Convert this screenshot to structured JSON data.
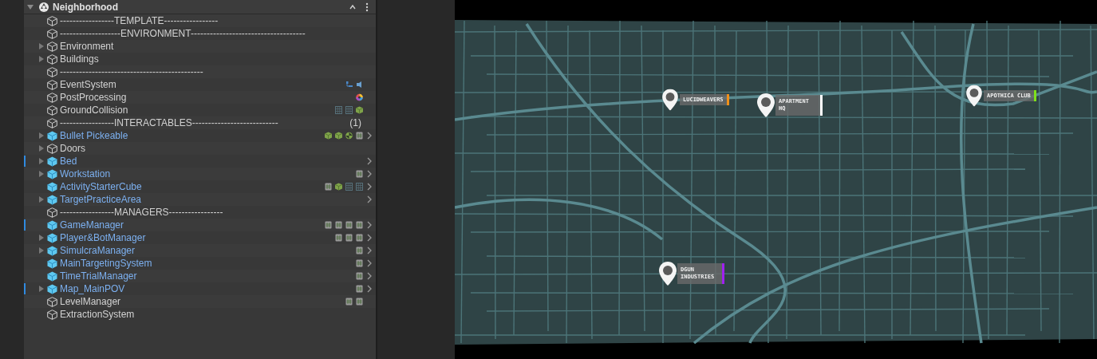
{
  "hierarchy": {
    "scene": {
      "label": "Neighborhood",
      "expanded": true
    },
    "rows": [
      {
        "label": "-----------------TEMPLATE-----------------",
        "prefab": false,
        "expandable": false,
        "marked": false,
        "chevron": false
      },
      {
        "label": "-------------------ENVIRONMENT------------------------------------",
        "prefab": false,
        "expandable": false,
        "marked": false,
        "chevron": false
      },
      {
        "label": "Environment",
        "prefab": false,
        "expandable": true,
        "marked": false,
        "chevron": false
      },
      {
        "label": "Buildings",
        "prefab": false,
        "expandable": true,
        "marked": false,
        "chevron": false
      },
      {
        "label": "---------------------------------------------",
        "prefab": false,
        "expandable": false,
        "marked": false,
        "chevron": false
      },
      {
        "label": "EventSystem",
        "prefab": false,
        "expandable": false,
        "marked": false,
        "components": [
          {
            "kind": "tree"
          },
          {
            "kind": "input"
          }
        ],
        "chevron": false
      },
      {
        "label": "PostProcessing",
        "prefab": false,
        "expandable": false,
        "marked": false,
        "components": [
          {
            "kind": "color"
          }
        ],
        "chevron": false
      },
      {
        "label": "GroundCollision",
        "prefab": false,
        "expandable": false,
        "marked": false,
        "components": [
          {
            "kind": "grid"
          },
          {
            "kind": "grid"
          },
          {
            "kind": "mesh"
          }
        ],
        "chevron": false
      },
      {
        "label": "-----------------INTERACTABLES---------------------------",
        "suffix": "(1)",
        "prefab": false,
        "expandable": false,
        "marked": false,
        "chevron": false
      },
      {
        "label": "Bullet Pickeable",
        "prefab": true,
        "expandable": true,
        "marked": false,
        "components": [
          {
            "kind": "mesh"
          },
          {
            "kind": "mesh"
          },
          {
            "kind": "ball"
          },
          {
            "kind": "script"
          }
        ],
        "chevron": true
      },
      {
        "label": "Doors",
        "prefab": false,
        "expandable": true,
        "marked": false,
        "chevron": false
      },
      {
        "label": "Bed",
        "prefab": true,
        "expandable": true,
        "marked": true,
        "chevron": true
      },
      {
        "label": "Workstation",
        "prefab": true,
        "expandable": true,
        "marked": false,
        "components": [
          {
            "kind": "script"
          }
        ],
        "chevron": true
      },
      {
        "label": "ActivityStarterCube",
        "prefab": true,
        "expandable": false,
        "marked": false,
        "components": [
          {
            "kind": "script"
          },
          {
            "kind": "mesh"
          },
          {
            "kind": "grid"
          },
          {
            "kind": "grid"
          }
        ],
        "chevron": true
      },
      {
        "label": "TargetPracticeArea",
        "prefab": true,
        "expandable": true,
        "marked": false,
        "chevron": true
      },
      {
        "label": "-----------------MANAGERS-----------------",
        "prefab": false,
        "expandable": false,
        "marked": false,
        "chevron": false
      },
      {
        "label": "GameManager",
        "prefab": true,
        "expandable": false,
        "marked": true,
        "components": [
          {
            "kind": "script"
          },
          {
            "kind": "script"
          },
          {
            "kind": "script"
          },
          {
            "kind": "script"
          }
        ],
        "chevron": true
      },
      {
        "label": "Player&BotManager",
        "prefab": true,
        "expandable": true,
        "marked": false,
        "components": [
          {
            "kind": "script"
          },
          {
            "kind": "script"
          },
          {
            "kind": "script"
          }
        ],
        "chevron": true
      },
      {
        "label": "SimulcraManager",
        "prefab": true,
        "expandable": true,
        "marked": false,
        "components": [
          {
            "kind": "script"
          }
        ],
        "chevron": true
      },
      {
        "label": "MainTargetingSystem",
        "prefab": true,
        "expandable": false,
        "marked": false,
        "components": [
          {
            "kind": "script"
          }
        ],
        "chevron": true
      },
      {
        "label": "TimeTrialManager",
        "prefab": true,
        "expandable": false,
        "marked": false,
        "components": [
          {
            "kind": "script"
          }
        ],
        "chevron": true
      },
      {
        "label": "Map_MainPOV",
        "prefab": true,
        "expandable": true,
        "marked": true,
        "components": [
          {
            "kind": "script"
          }
        ],
        "chevron": true
      },
      {
        "label": "LevelManager",
        "prefab": false,
        "expandable": false,
        "marked": false,
        "components": [
          {
            "kind": "script"
          },
          {
            "kind": "script"
          }
        ],
        "chevron": false
      },
      {
        "label": "ExtractionSystem",
        "prefab": false,
        "expandable": false,
        "marked": false,
        "chevron": false
      }
    ]
  },
  "map": {
    "pins": [
      {
        "label": "LUCIDWEAVERS",
        "color": "#f0901a"
      },
      {
        "label": "APARTMENT HQ",
        "color": "#ffffff"
      },
      {
        "label": "APOTHICA CLUB",
        "color": "#7ee01a"
      },
      {
        "label": "DGUN INDUSTRIES",
        "color": "#a020f0"
      }
    ]
  }
}
